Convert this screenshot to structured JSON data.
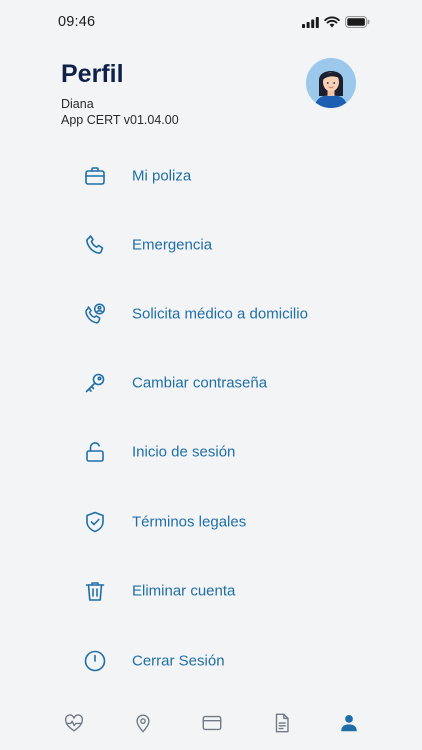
{
  "status_bar": {
    "time": "09:46",
    "icons": [
      "signal-icon",
      "wifi-icon",
      "battery-icon"
    ]
  },
  "profile": {
    "title": "Perfil",
    "user_name": "Diana",
    "app_version": "App CERT v01.04.00"
  },
  "colors": {
    "accent": "#1f6fa6",
    "title": "#0f2148",
    "background": "#f3f4f6",
    "avatar_bg": "#9cc8ec"
  },
  "menu": {
    "items": [
      {
        "label": "Mi poliza",
        "icon": "briefcase-icon"
      },
      {
        "label": "Emergencia",
        "icon": "phone-icon"
      },
      {
        "label": "Solicita médico a domicilio",
        "icon": "phone-doctor-icon"
      },
      {
        "label": "Cambiar contraseña",
        "icon": "key-icon"
      },
      {
        "label": "Inicio de sesión",
        "icon": "unlock-icon"
      },
      {
        "label": "Términos legales",
        "icon": "shield-check-icon"
      },
      {
        "label": "Eliminar cuenta",
        "icon": "trash-icon"
      },
      {
        "label": "Cerrar Sesión",
        "icon": "power-icon"
      }
    ]
  },
  "bottom_nav": {
    "items": [
      {
        "icon": "heart-pulse-icon",
        "active": false
      },
      {
        "icon": "location-pin-icon",
        "active": false
      },
      {
        "icon": "card-icon",
        "active": false
      },
      {
        "icon": "document-icon",
        "active": false
      },
      {
        "icon": "profile-icon",
        "active": true
      }
    ]
  }
}
